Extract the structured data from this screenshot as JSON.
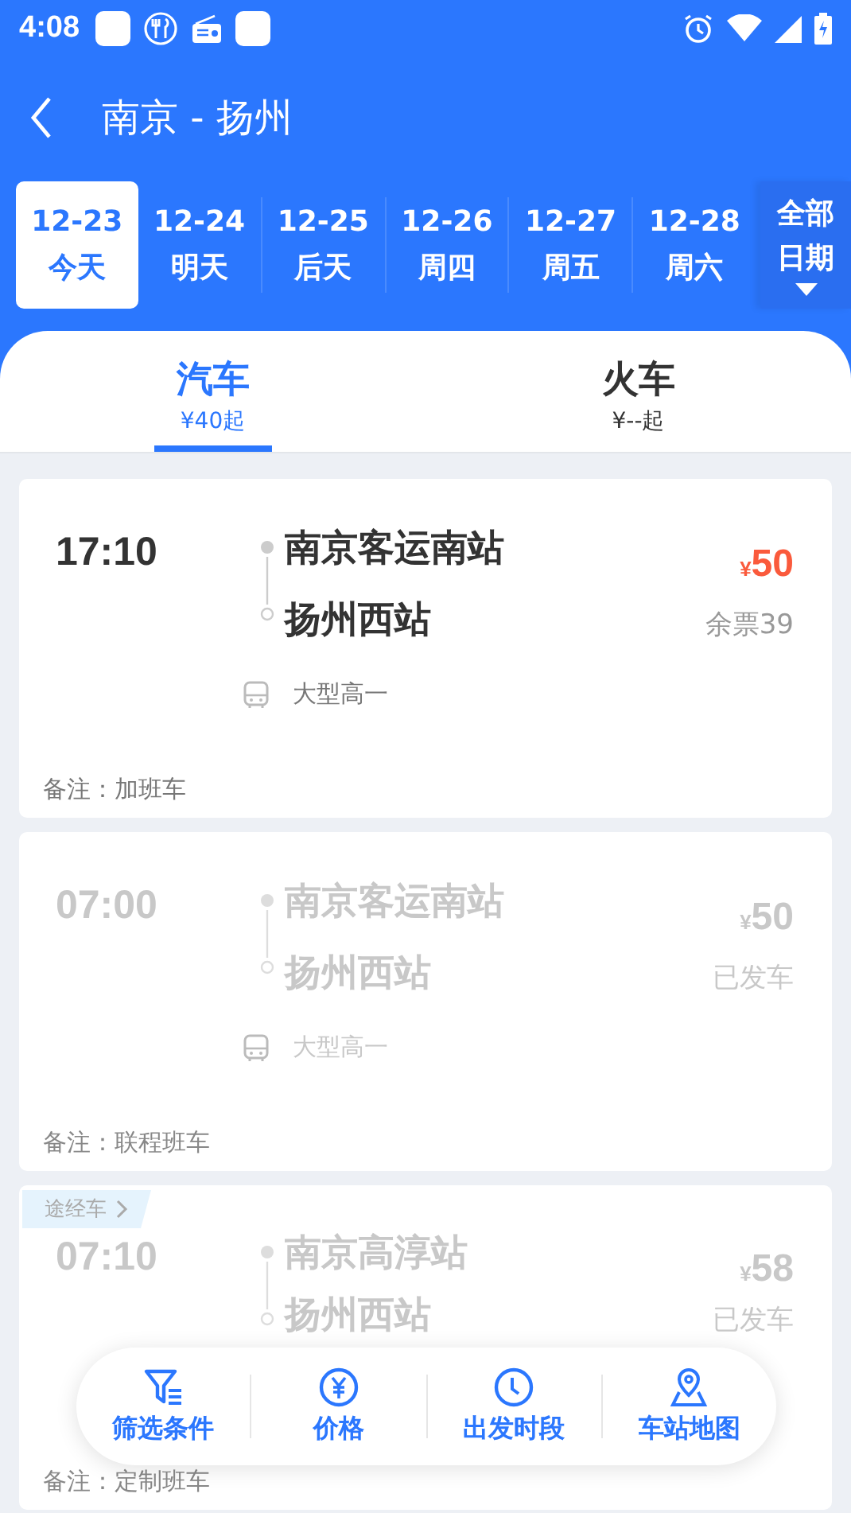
{
  "status_bar": {
    "time": "4:08"
  },
  "header": {
    "title": "南京 - 扬州"
  },
  "dates": [
    {
      "date": "12-23",
      "day": "今天",
      "selected": true
    },
    {
      "date": "12-24",
      "day": "明天",
      "selected": false
    },
    {
      "date": "12-25",
      "day": "后天",
      "selected": false
    },
    {
      "date": "12-26",
      "day": "周四",
      "selected": false
    },
    {
      "date": "12-27",
      "day": "周五",
      "selected": false
    },
    {
      "date": "12-28",
      "day": "周六",
      "selected": false
    }
  ],
  "all_dates": {
    "line1": "全部",
    "line2": "日期"
  },
  "mode_tabs": [
    {
      "label": "汽车",
      "price": "¥40起",
      "selected": true
    },
    {
      "label": "火车",
      "price": "¥--起",
      "selected": false
    }
  ],
  "trips": [
    {
      "time": "17:10",
      "from": "南京客运南站",
      "to": "扬州西站",
      "currency": "¥",
      "price": "50",
      "status": "余票39",
      "departed": false,
      "bus_type": "大型高一",
      "remark": "备注：加班车"
    },
    {
      "time": "07:00",
      "from": "南京客运南站",
      "to": "扬州西站",
      "currency": "¥",
      "price": "50",
      "status": "已发车",
      "departed": true,
      "bus_type": "大型高一",
      "remark": "备注：联程班车"
    },
    {
      "badge": "途经车",
      "time": "07:10",
      "from": "南京高淳站",
      "to": "扬州西站",
      "currency": "¥",
      "price": "58",
      "status": "已发车",
      "departed": true,
      "remark": "备注：定制班车"
    }
  ],
  "bottom_bar": [
    {
      "kind": "filter",
      "label": "筛选条件"
    },
    {
      "kind": "price",
      "label": "价格"
    },
    {
      "kind": "time",
      "label": "出发时段"
    },
    {
      "kind": "map",
      "label": "车站地图"
    }
  ]
}
